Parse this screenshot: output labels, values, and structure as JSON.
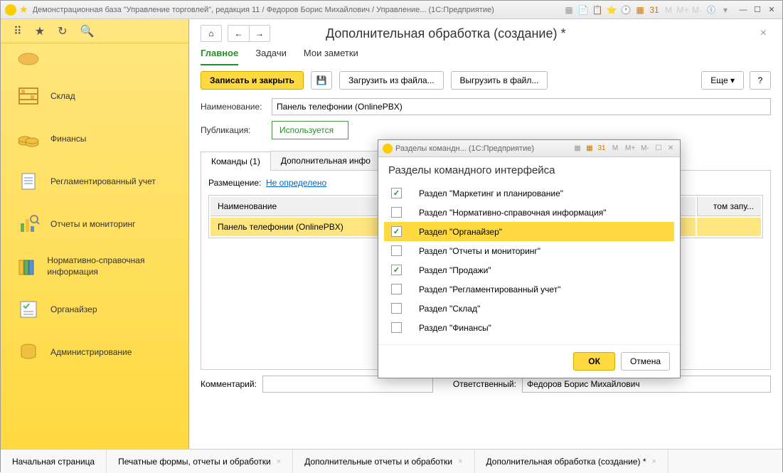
{
  "titlebar": {
    "text": "Демонстрационная база \"Управление торговлей\", редакция 11 / Федоров Борис Михайлович / Управление...   (1С:Предприятие)"
  },
  "sidebar": {
    "items": [
      {
        "label": ""
      },
      {
        "label": "Склад"
      },
      {
        "label": "Финансы"
      },
      {
        "label": "Регламентированный учет"
      },
      {
        "label": "Отчеты и мониторинг"
      },
      {
        "label": "Нормативно-справочная информация"
      },
      {
        "label": "Органайзер"
      },
      {
        "label": "Администрирование"
      }
    ]
  },
  "page": {
    "title": "Дополнительная обработка (создание) *",
    "tabs": {
      "main": "Главное",
      "tasks": "Задачи",
      "notes": "Мои заметки"
    },
    "toolbar": {
      "save_close": "Записать и закрыть",
      "load": "Загрузить из файла...",
      "export": "Выгрузить в файл...",
      "more": "Еще",
      "help": "?"
    },
    "form": {
      "name_label": "Наименование:",
      "name_value": "Панель телефонии (OnlinePBX)",
      "pub_label": "Публикация:",
      "pub_value": "Используется"
    },
    "inner_tabs": {
      "commands": "Команды (1)",
      "info": "Дополнительная инфо"
    },
    "placement": {
      "label": "Размещение:",
      "link": "Не определено"
    },
    "table": {
      "col1": "Наименование",
      "col2_suffix": "том запу...",
      "row1": "Панель телефонии (OnlinePBX)"
    },
    "comment": {
      "label": "Комментарий:",
      "resp_label": "Ответственный:",
      "resp_value": "Федоров Борис Михайлович"
    }
  },
  "bottom_tabs": {
    "t1": "Начальная страница",
    "t2": "Печатные формы, отчеты и обработки",
    "t3": "Дополнительные отчеты и обработки",
    "t4": "Дополнительная обработка (создание) *"
  },
  "modal": {
    "titlebar": "Разделы командн...   (1С:Предприятие)",
    "header": "Разделы командного интерфейса",
    "items": [
      {
        "checked": true,
        "label": "Раздел \"Маркетинг и планирование\""
      },
      {
        "checked": false,
        "label": "Раздел \"Нормативно-справочная информация\""
      },
      {
        "checked": true,
        "label": "Раздел \"Органайзер\"",
        "selected": true
      },
      {
        "checked": false,
        "label": "Раздел \"Отчеты и мониторинг\""
      },
      {
        "checked": true,
        "label": "Раздел \"Продажи\""
      },
      {
        "checked": false,
        "label": "Раздел \"Регламентированный учет\""
      },
      {
        "checked": false,
        "label": "Раздел \"Склад\""
      },
      {
        "checked": false,
        "label": "Раздел \"Финансы\""
      }
    ],
    "ok": "ОК",
    "cancel": "Отмена",
    "mem": {
      "m": "M",
      "mplus": "M+",
      "mminus": "M-"
    }
  }
}
